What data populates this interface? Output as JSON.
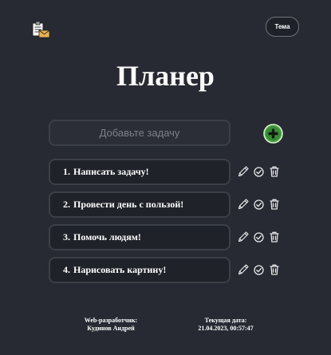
{
  "header": {
    "logo_icon": "clipboard-mail-icon",
    "theme_label": "Тема"
  },
  "title": "Планер",
  "add_task": {
    "placeholder": "Добавьте задачу",
    "add_icon": "plus-circle-icon",
    "accent_color": "#3f8f3a"
  },
  "tasks": [
    {
      "number": "1.",
      "text": "Написать задачу!"
    },
    {
      "number": "2.",
      "text": "Провести день с пользой!"
    },
    {
      "number": "3.",
      "text": "Помочь людям!"
    },
    {
      "number": "4.",
      "text": "Нарисовать картину!"
    }
  ],
  "task_action_icons": [
    "pencil-icon",
    "check-circle-icon",
    "trash-icon"
  ],
  "footer": {
    "developer_label": "Web-разработчик:",
    "developer_name": "Кудинов Андрей",
    "date_label": "Текущая дата:",
    "date_value": "21.04.2023, 00:57:47"
  }
}
